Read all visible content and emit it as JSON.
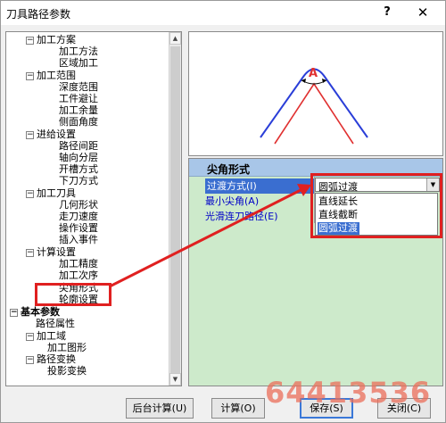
{
  "window": {
    "title": "刀具路径参数",
    "help_label": "?",
    "close_label": "✕"
  },
  "tree": [
    {
      "label": "加工方案",
      "expander": "−",
      "bold": false
    },
    {
      "label": "加工方法",
      "expander": "",
      "bold": false
    },
    {
      "label": "区域加工",
      "expander": "",
      "bold": false
    },
    {
      "label": "加工范围",
      "expander": "−",
      "bold": false
    },
    {
      "label": "深度范围",
      "expander": "",
      "bold": false
    },
    {
      "label": "工件避让",
      "expander": "",
      "bold": false
    },
    {
      "label": "加工余量",
      "expander": "",
      "bold": false
    },
    {
      "label": "侧面角度",
      "expander": "",
      "bold": false
    },
    {
      "label": "进给设置",
      "expander": "−",
      "bold": false
    },
    {
      "label": "路径间距",
      "expander": "",
      "bold": false
    },
    {
      "label": "轴向分层",
      "expander": "",
      "bold": false
    },
    {
      "label": "开槽方式",
      "expander": "",
      "bold": false
    },
    {
      "label": "下刀方式",
      "expander": "",
      "bold": false
    },
    {
      "label": "加工刀具",
      "expander": "−",
      "bold": false
    },
    {
      "label": "几何形状",
      "expander": "",
      "bold": false
    },
    {
      "label": "走刀速度",
      "expander": "",
      "bold": false
    },
    {
      "label": "操作设置",
      "expander": "",
      "bold": false
    },
    {
      "label": "插入事件",
      "expander": "",
      "bold": false
    },
    {
      "label": "计算设置",
      "expander": "−",
      "bold": false
    },
    {
      "label": "加工精度",
      "expander": "",
      "bold": false
    },
    {
      "label": "加工次序",
      "expander": "",
      "bold": false
    },
    {
      "label": "尖角形式",
      "expander": "",
      "bold": false
    },
    {
      "label": "轮廓设置",
      "expander": "",
      "bold": false
    },
    {
      "label": "基本参数",
      "expander": "−",
      "bold": true
    },
    {
      "label": "路径属性",
      "expander": "",
      "bold": false
    },
    {
      "label": "加工域",
      "expander": "−",
      "bold": false
    },
    {
      "label": "加工图形",
      "expander": "",
      "bold": false
    },
    {
      "label": "路径变换",
      "expander": "−",
      "bold": false
    },
    {
      "label": "投影变换",
      "expander": "",
      "bold": false
    }
  ],
  "preview": {
    "angle_label": "A"
  },
  "properties": {
    "header": "尖角形式",
    "rows": [
      {
        "label": "过渡方式(I)"
      },
      {
        "label": "最小尖角(A)"
      },
      {
        "label": "光滑连刀路径(E)"
      }
    ],
    "combo_value": "圆弧过渡",
    "options": [
      "直线延长",
      "直线截断",
      "圆弧过渡"
    ]
  },
  "buttons": {
    "background_calc": "后台计算(U)",
    "calc": "计算(O)",
    "save": "保存(S)",
    "close": "关闭(C)"
  },
  "watermark": "64413536",
  "colors": {
    "annotation_red": "#e02020",
    "selection_blue": "#3a6ed0",
    "panel_green": "#cdeacb",
    "header_blue": "#a8c6e8"
  }
}
